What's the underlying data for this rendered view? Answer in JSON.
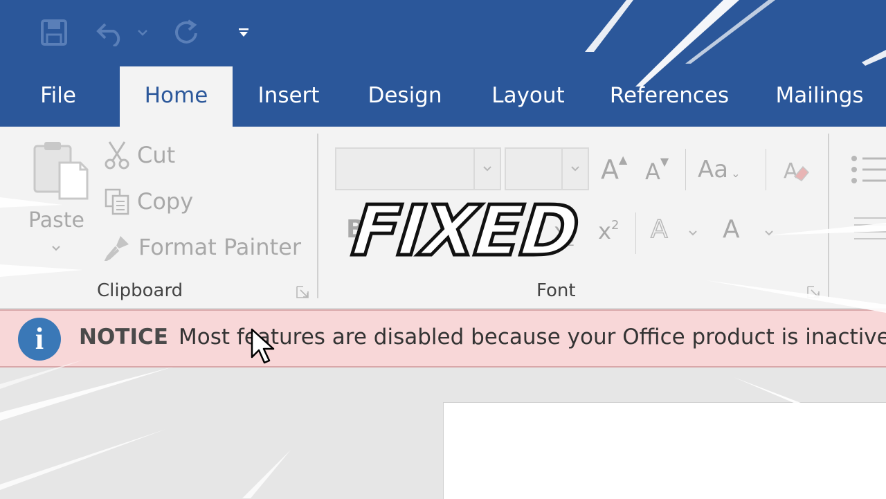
{
  "quick_access": {
    "icons": [
      "save-icon",
      "undo-icon",
      "redo-icon",
      "customize-quick-access-icon"
    ]
  },
  "tabs": [
    {
      "label": "File",
      "active": false
    },
    {
      "label": "Home",
      "active": true
    },
    {
      "label": "Insert",
      "active": false
    },
    {
      "label": "Design",
      "active": false
    },
    {
      "label": "Layout",
      "active": false
    },
    {
      "label": "References",
      "active": false
    },
    {
      "label": "Mailings",
      "active": false
    }
  ],
  "clipboard": {
    "paste_label": "Paste",
    "cut_label": "Cut",
    "copy_label": "Copy",
    "format_painter_label": "Format Painter",
    "group_label": "Clipboard"
  },
  "font": {
    "font_name_value": "",
    "font_size_value": "",
    "grow_font": "A",
    "shrink_font": "A",
    "change_case": "Aa",
    "bold": "B",
    "subscript": "x",
    "subscript_mark": "2",
    "superscript": "x",
    "superscript_mark": "2",
    "text_effects": "A",
    "font_color": "A",
    "group_label": "Font"
  },
  "notice": {
    "title": "NOTICE",
    "message": "Most features are disabled because your Office product is inactive. T"
  },
  "overlay": {
    "text": "FIXED"
  },
  "colors": {
    "ribbon_blue": "#2b579a",
    "notice_bg": "#f8d7d8",
    "info_icon": "#3a78b7"
  }
}
